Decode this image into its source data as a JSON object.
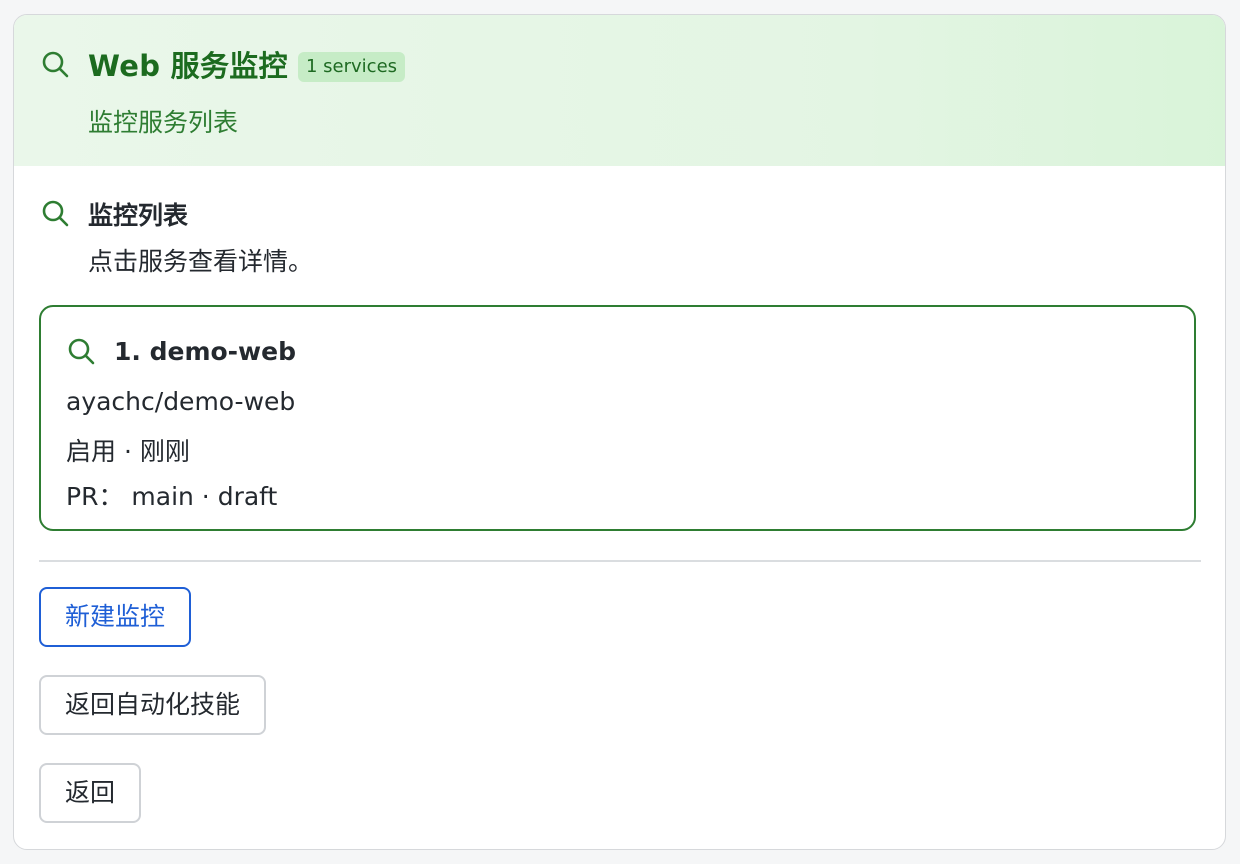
{
  "header": {
    "title": "Web 服务监控",
    "badge": "1 services",
    "subtitle": "监控服务列表",
    "icon": "search-icon"
  },
  "section": {
    "title": "监控列表",
    "description": "点击服务查看详情。",
    "icon": "search-icon"
  },
  "services": [
    {
      "name": "1. demo-web",
      "repo": "ayachc/demo-web",
      "status": "启用 · 刚刚",
      "pr": "PR： main · draft",
      "icon": "search-icon"
    }
  ],
  "actions": {
    "new_monitor": "新建监控",
    "back_to_automation": "返回自动化技能",
    "back": "返回"
  },
  "colors": {
    "accent_green": "#2e7d32",
    "title_green": "#1c6b1f",
    "badge_bg": "#c6ecc6",
    "primary_blue": "#1f5fd6",
    "border_gray": "#cfd2d6"
  }
}
